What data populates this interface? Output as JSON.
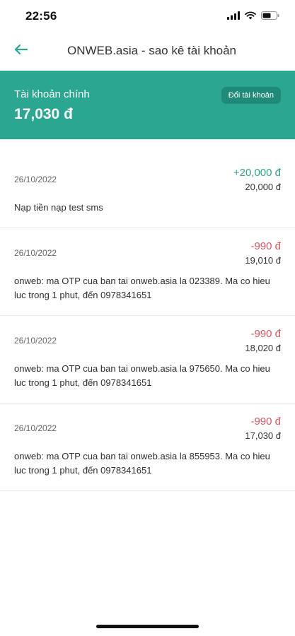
{
  "status_bar": {
    "time": "22:56",
    "icons": [
      "signal-icon",
      "wifi-icon",
      "battery-icon"
    ]
  },
  "nav": {
    "title": "ONWEB.asia - sao kê tài khoản",
    "back_icon": "arrow-left-icon"
  },
  "account": {
    "label": "Tài khoản chính",
    "balance": "17,030 đ",
    "switch_button": "Đổi tài khoản"
  },
  "transactions": [
    {
      "date": "26/10/2022",
      "amount": "+20,000 đ",
      "balance": "20,000 đ",
      "description": "Nạp tiền nạp test sms",
      "type": "credit"
    },
    {
      "date": "26/10/2022",
      "amount": "-990 đ",
      "balance": "19,010 đ",
      "description": "onweb: ma OTP cua ban tai onweb.asia la 023389. Ma co hieu luc trong 1 phut, đến 0978341651",
      "type": "debit"
    },
    {
      "date": "26/10/2022",
      "amount": "-990 đ",
      "balance": "18,020 đ",
      "description": "onweb: ma OTP cua ban tai onweb.asia la 975650. Ma co hieu luc trong 1 phut, đến 0978341651",
      "type": "debit"
    },
    {
      "date": "26/10/2022",
      "amount": "-990 đ",
      "balance": "17,030 đ",
      "description": "onweb: ma OTP cua ban tai onweb.asia la 855953. Ma co hieu luc trong 1 phut, đến 0978341651",
      "type": "debit"
    }
  ],
  "colors": {
    "accent": "#2aa691",
    "accent_dark": "#1e8a77",
    "credit": "#2aa691",
    "debit": "#e05660"
  }
}
